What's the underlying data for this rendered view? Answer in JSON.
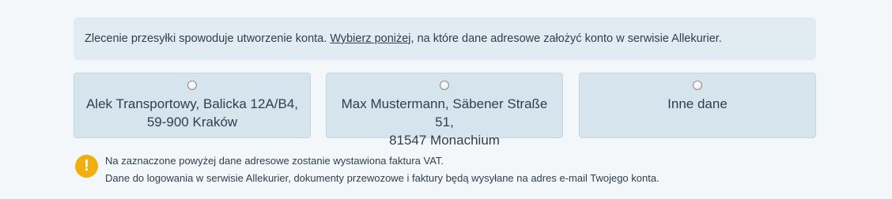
{
  "notice": {
    "text_before": "Zlecenie przesyłki spowoduje utworzenie konta.",
    "link": "Wybierz poniżej",
    "text_after": ", na które dane adresowe założyć konto w serwisie Allekurier."
  },
  "options": [
    {
      "line1": "Alek Transportowy, Balicka 12A/B4,",
      "line2": "59-900 Kraków",
      "selected": false
    },
    {
      "line1": "Max Mustermann, Säbener Straße 51,",
      "line2": "81547 Monachium",
      "selected": false
    },
    {
      "line1": "Inne dane",
      "selected": false
    }
  ],
  "info": {
    "icon": "exclamation-icon",
    "line1": "Na zaznaczone powyżej dane adresowe zostanie wystawiona faktura VAT.",
    "line2": "Dane do logowania w serwisie Allekurier, dokumenty przewozowe i faktury będą wysyłane na adres e-mail Twojego konta.",
    "accent_color": "#f2ad0f"
  }
}
